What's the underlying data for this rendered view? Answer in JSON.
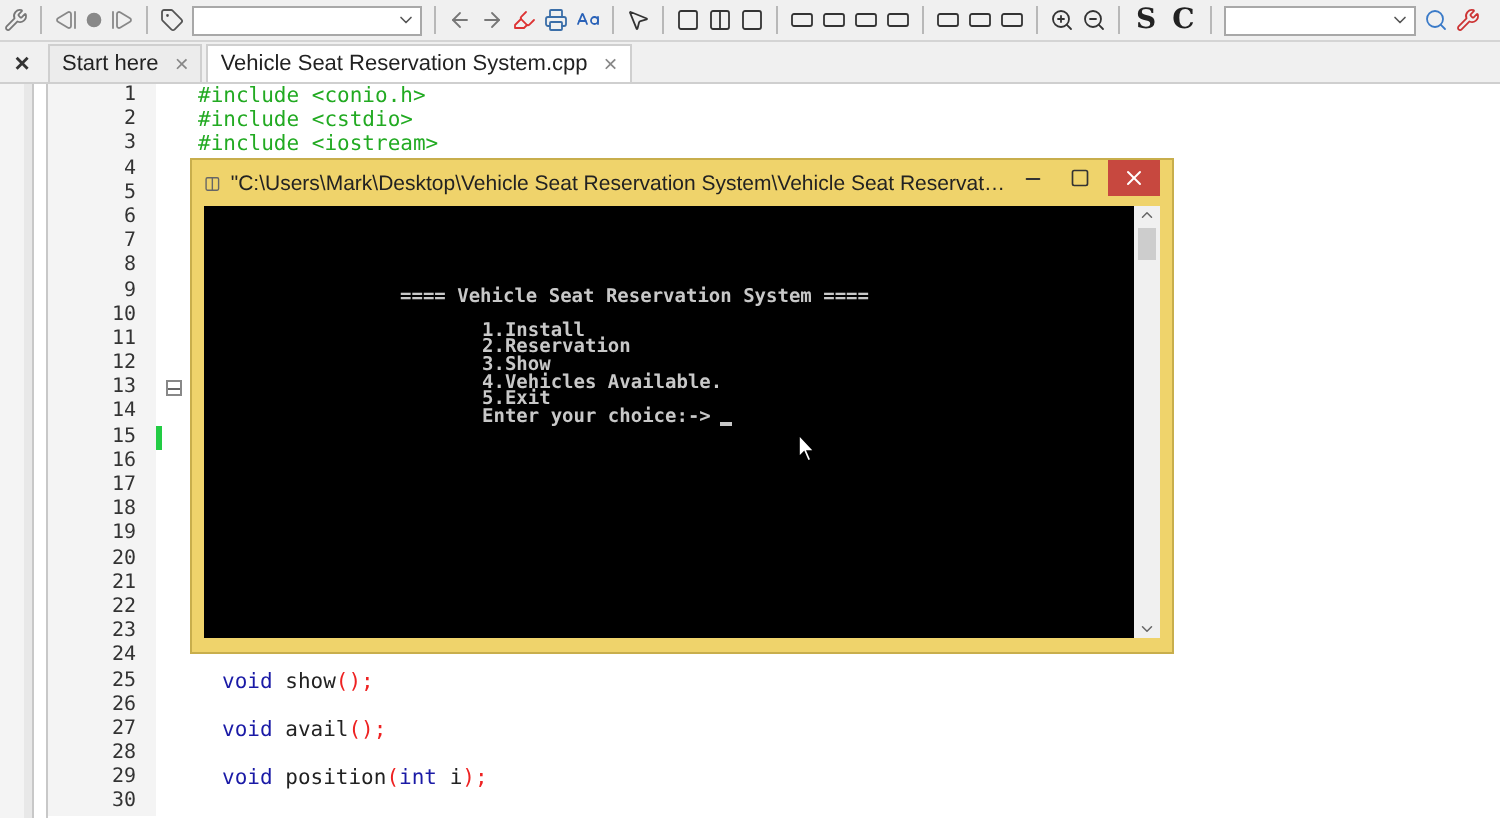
{
  "toolbar": {
    "text_buttons": [
      "S",
      "C"
    ]
  },
  "side_panel": {
    "close": "×"
  },
  "tabs": [
    {
      "label": "Start here",
      "close": "×",
      "selected": false
    },
    {
      "label": "Vehicle Seat Reservation System.cpp",
      "close": "×",
      "selected": true
    }
  ],
  "editor": {
    "lines": [
      {
        "number": "1",
        "tokens": [
          {
            "kind": "preproc",
            "text": "#include <conio.h>"
          }
        ]
      },
      {
        "number": "2",
        "tokens": [
          {
            "kind": "preproc",
            "text": "#include <cstdio>"
          }
        ]
      },
      {
        "number": "3",
        "tokens": [
          {
            "kind": "preproc",
            "text": "#include <iostream>"
          }
        ]
      },
      {
        "number": "4"
      },
      {
        "number": "5"
      },
      {
        "number": "6"
      },
      {
        "number": "7"
      },
      {
        "number": "8"
      },
      {
        "number": "9"
      },
      {
        "number": "10"
      },
      {
        "number": "11"
      },
      {
        "number": "12"
      },
      {
        "number": "13",
        "fold": true
      },
      {
        "number": "14"
      },
      {
        "number": "15",
        "changed": true
      },
      {
        "number": "16"
      },
      {
        "number": "17"
      },
      {
        "number": "18"
      },
      {
        "number": "19"
      },
      {
        "number": "20"
      },
      {
        "number": "21"
      },
      {
        "number": "22"
      },
      {
        "number": "23"
      },
      {
        "number": "24"
      },
      {
        "number": "25",
        "tokens": [
          {
            "kind": "keyword",
            "text": "void"
          },
          {
            "kind": "ident",
            "text": " show"
          },
          {
            "kind": "punct",
            "text": "();"
          }
        ]
      },
      {
        "number": "26"
      },
      {
        "number": "27",
        "tokens": [
          {
            "kind": "keyword",
            "text": "void"
          },
          {
            "kind": "ident",
            "text": " avail"
          },
          {
            "kind": "punct",
            "text": "();"
          }
        ]
      },
      {
        "number": "28"
      },
      {
        "number": "29",
        "tokens": [
          {
            "kind": "keyword",
            "text": "void"
          },
          {
            "kind": "ident",
            "text": " position"
          },
          {
            "kind": "punct",
            "text": "("
          },
          {
            "kind": "keyword",
            "text": "int"
          },
          {
            "kind": "ident",
            "text": " i"
          },
          {
            "kind": "punct",
            "text": ");"
          }
        ]
      },
      {
        "number": "30"
      }
    ]
  },
  "console": {
    "title": "\"C:\\Users\\Mark\\Desktop\\Vehicle Seat Reservation System\\Vehicle Seat Reservat…",
    "heading": "==== Vehicle Seat Reservation System ====",
    "menu": [
      "1.Install",
      "2.Reservation",
      "3.Show",
      "4.Vehicles Available.",
      "5.Exit"
    ],
    "prompt": "Enter your choice:->"
  }
}
